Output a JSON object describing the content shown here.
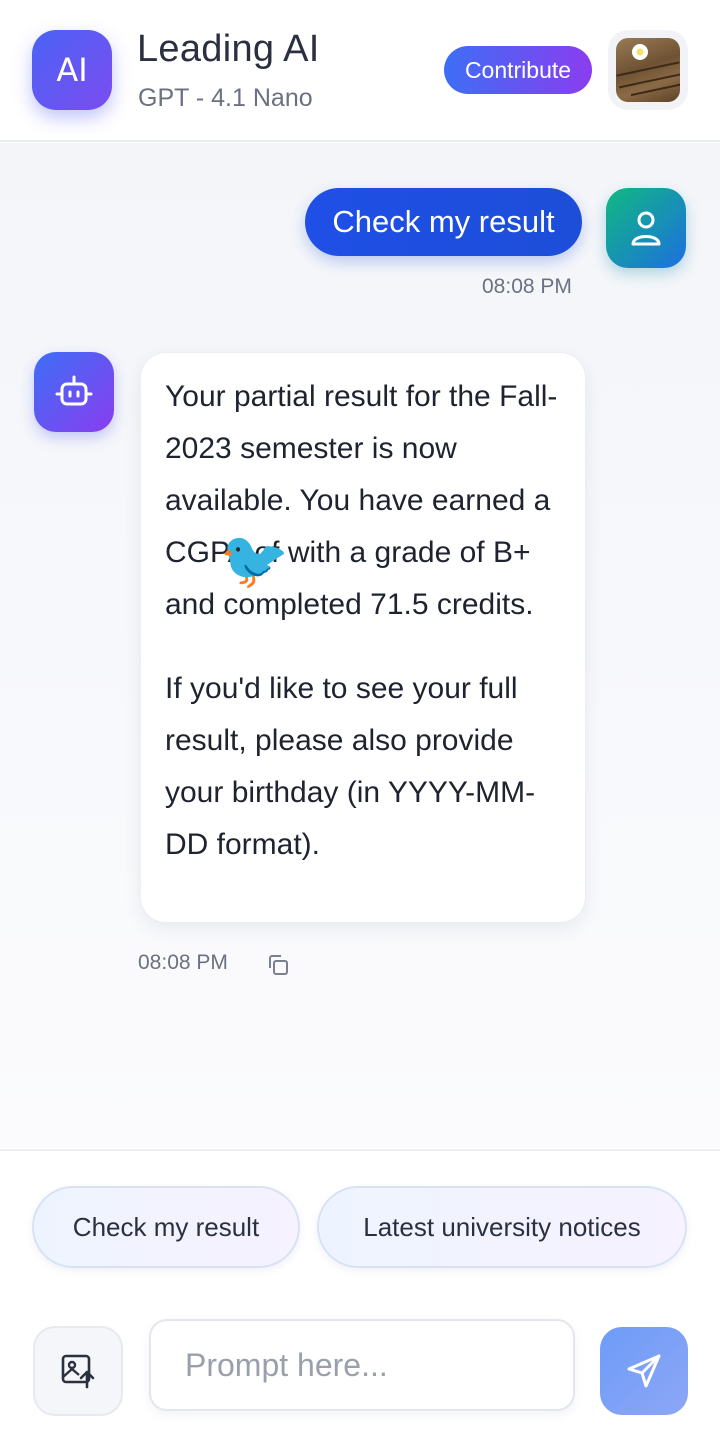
{
  "header": {
    "logo_text": "AI",
    "title": "Leading AI",
    "subtitle": "GPT - 4.1 Nano",
    "contribute_label": "Contribute",
    "avatar_icon": "profile-photo"
  },
  "chat": {
    "user_message": {
      "text": "Check my result",
      "time": "08:08 PM",
      "avatar_icon": "user-icon"
    },
    "bot_message": {
      "avatar_icon": "robot-icon",
      "paragraph_1_before": "Your partial result for the Fall-2023 semester is now available. You have earned a CGPA of",
      "paragraph_1_after": "with a grade of B+ and completed 71.5 credits.",
      "emoji": "🐦",
      "paragraph_2": "If you'd like to see your full result, please also provide your birthday (in YYYY-MM-DD format).",
      "time": "08:08 PM",
      "copy_icon": "copy-icon"
    }
  },
  "suggestions": [
    {
      "label": "Check my result"
    },
    {
      "label": "Latest university notices"
    }
  ],
  "composer": {
    "upload_icon": "image-upload-icon",
    "placeholder": "Prompt here...",
    "send_icon": "send-icon"
  },
  "colors": {
    "primary_blue": "#1d4ed8",
    "accent_purple": "#8a3df0",
    "user_avatar_teal": "#10b981"
  }
}
